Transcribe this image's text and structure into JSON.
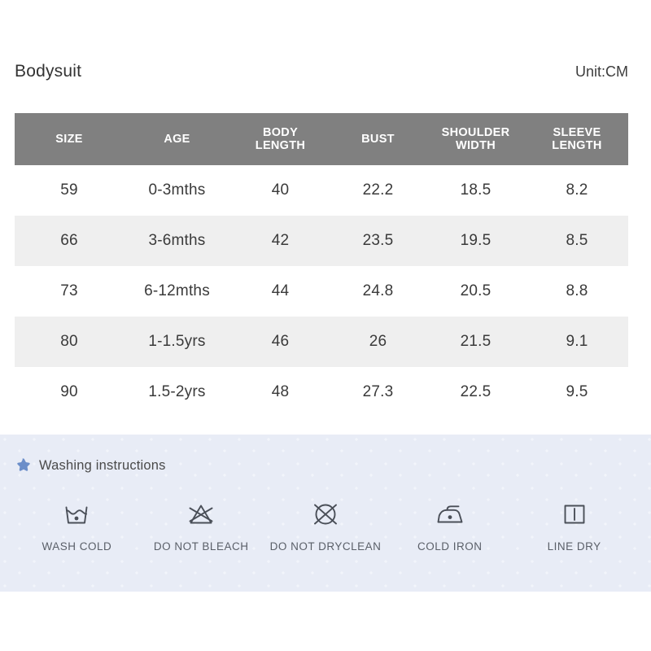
{
  "header": {
    "title": "Bodysuit",
    "unit": "Unit:CM"
  },
  "table": {
    "columns": [
      {
        "line1": "SIZE",
        "line2": ""
      },
      {
        "line1": "AGE",
        "line2": ""
      },
      {
        "line1": "BODY",
        "line2": "LENGTH"
      },
      {
        "line1": "BUST",
        "line2": ""
      },
      {
        "line1": "SHOULDER",
        "line2": "WIDTH"
      },
      {
        "line1": "SLEEVE",
        "line2": "LENGTH"
      }
    ],
    "rows": [
      {
        "size": "59",
        "age": "0-3mths",
        "body_length": "40",
        "bust": "22.2",
        "shoulder_width": "18.5",
        "sleeve_length": "8.2"
      },
      {
        "size": "66",
        "age": "3-6mths",
        "body_length": "42",
        "bust": "23.5",
        "shoulder_width": "19.5",
        "sleeve_length": "8.5"
      },
      {
        "size": "73",
        "age": "6-12mths",
        "body_length": "44",
        "bust": "24.8",
        "shoulder_width": "20.5",
        "sleeve_length": "8.8"
      },
      {
        "size": "80",
        "age": "1-1.5yrs",
        "body_length": "46",
        "bust": "26",
        "shoulder_width": "21.5",
        "sleeve_length": "9.1"
      },
      {
        "size": "90",
        "age": "1.5-2yrs",
        "body_length": "48",
        "bust": "27.3",
        "shoulder_width": "22.5",
        "sleeve_length": "9.5"
      }
    ]
  },
  "washing": {
    "heading": "Washing instructions",
    "bullet_icon": "star-icon",
    "items": [
      {
        "icon": "wash-tub-icon",
        "label": "WASH COLD"
      },
      {
        "icon": "no-bleach-icon",
        "label": "DO NOT BLEACH"
      },
      {
        "icon": "no-dryclean-icon",
        "label": "DO NOT DRYCLEAN"
      },
      {
        "icon": "iron-low-heat-icon",
        "label": "COLD IRON"
      },
      {
        "icon": "line-dry-icon",
        "label": "LINE DRY"
      }
    ]
  },
  "colors": {
    "header_band": "#808080",
    "zebra_row": "#efefef",
    "wash_panel_bg": "#e8ecf6",
    "star_blue": "#6b8ec9",
    "icon_stroke": "#4a4f58",
    "text": "#3a3a3a"
  }
}
